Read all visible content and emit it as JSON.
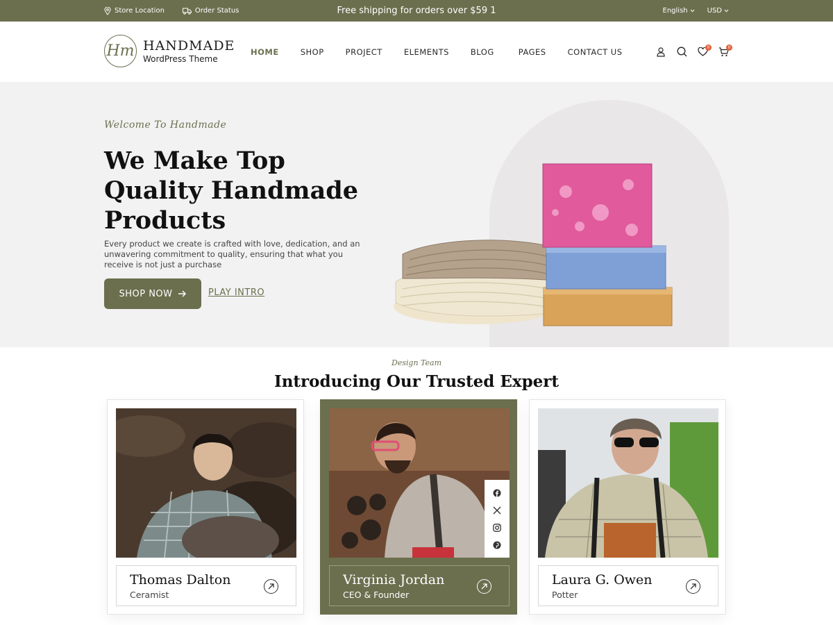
{
  "topbar": {
    "store_location": "Store Location",
    "order_status": "Order Status",
    "promo": "Free shipping for orders over $59 1",
    "language": "English",
    "currency": "USD"
  },
  "header": {
    "logo_mark": "Hm",
    "logo_name": "HANDMADE",
    "logo_sub": "WordPress Theme",
    "nav": [
      "HOME",
      "SHOP",
      "PROJECT",
      "ELEMENTS",
      "BLOG",
      "PAGES",
      "CONTACT US"
    ],
    "wishlist_count": "0",
    "cart_count": "0"
  },
  "hero": {
    "welcome": "Welcome To Handmade",
    "title_lines": [
      "We Make Top",
      "Quality Handmade",
      "Products"
    ],
    "description": "Every product we create is crafted with love, dedication, and an unwavering commitment to quality, ensuring that what you receive is not just a purchase",
    "shop_button": "SHOP NOW",
    "intro_button": "PLAY INTRO"
  },
  "team": {
    "kicker": "Design Team",
    "title": "Introducing Our Trusted Expert",
    "members": [
      {
        "name": "Thomas Dalton",
        "role": "Ceramist"
      },
      {
        "name": "Virginia Jordan",
        "role": "CEO & Founder"
      },
      {
        "name": "Laura G. Owen",
        "role": "Potter"
      }
    ]
  },
  "colors": {
    "brand": "#6b6f4e",
    "badge": "#e0603a",
    "hero_bg": "#f2f2f2"
  }
}
